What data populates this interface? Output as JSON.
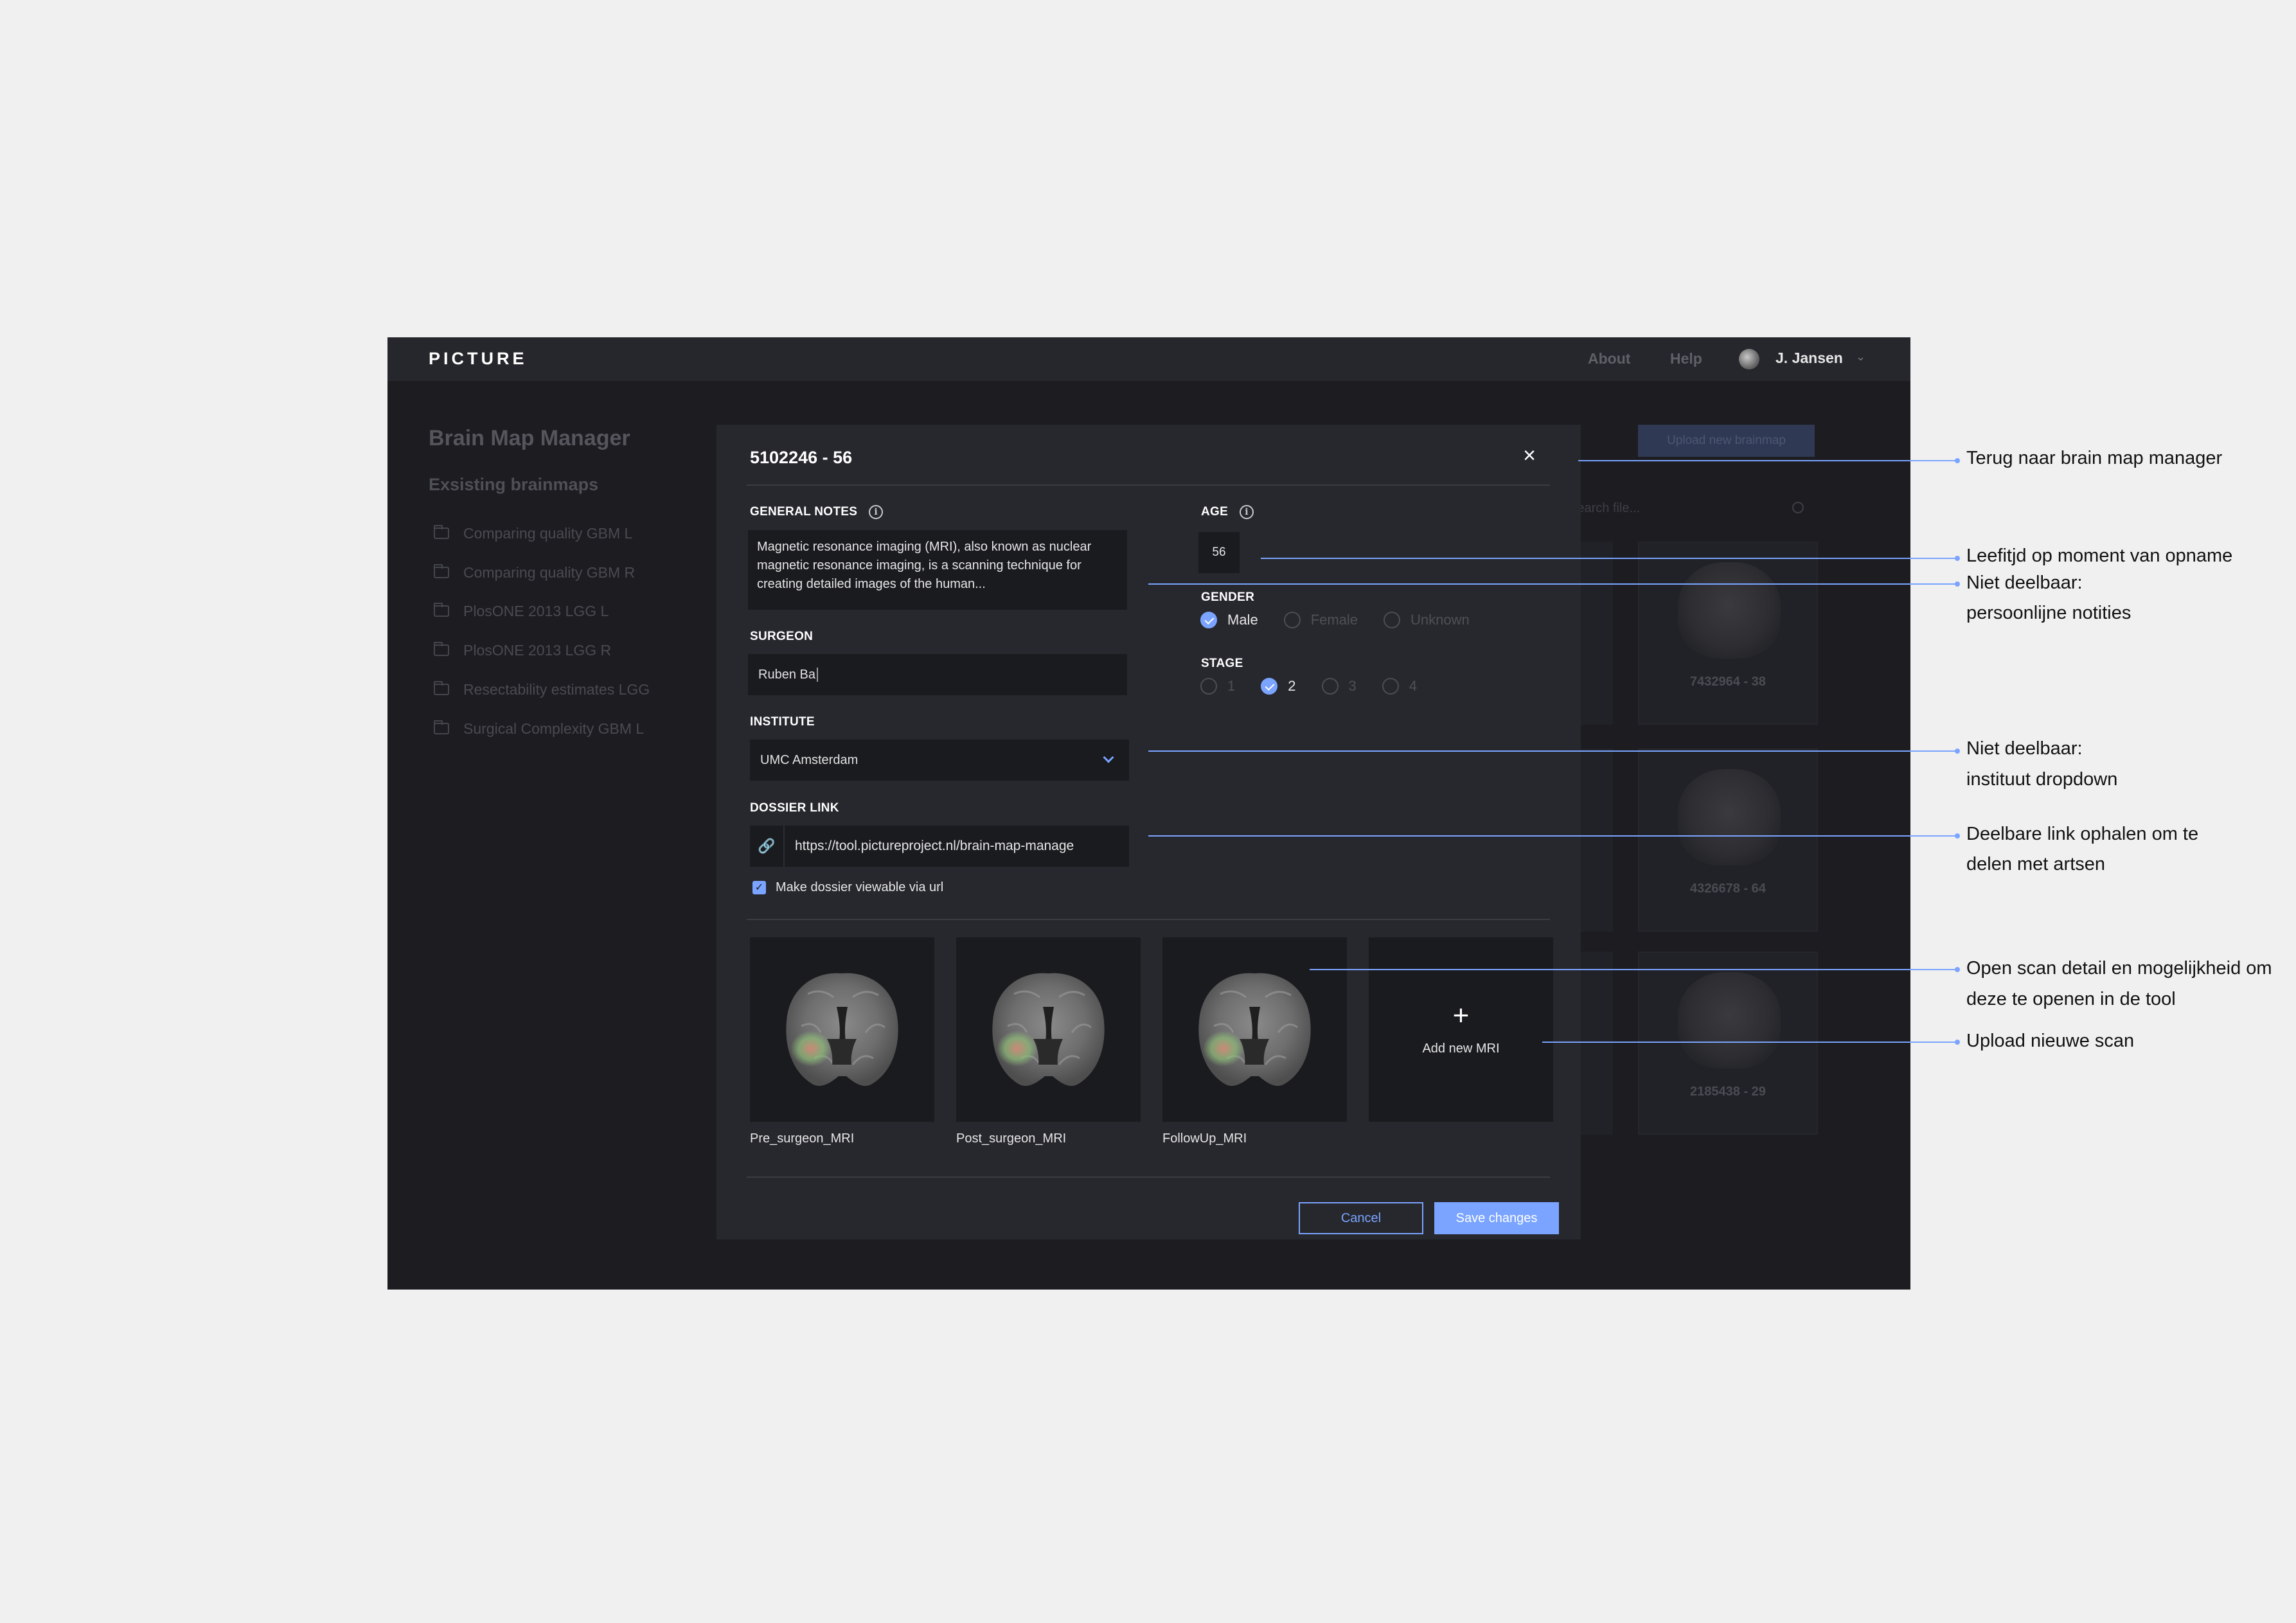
{
  "app": {
    "logo": "PICTURE",
    "nav": {
      "about": "About",
      "help": "Help"
    },
    "user": {
      "name": "J. Jansen"
    }
  },
  "background": {
    "title": "Brain Map Manager",
    "subtitle": "Exsisting brainmaps",
    "folders": [
      "Comparing quality GBM L",
      "Comparing quality GBM R",
      "PlosONE 2013 LGG L",
      "PlosONE 2013 LGG R",
      "Resectability estimates LGG",
      "Surgical Complexity GBM L"
    ],
    "upload_button": "Upload new brainmap",
    "search_placeholder": "Search file...",
    "cards": [
      {
        "name": "7432964 - 38"
      },
      {
        "name": "4326678 - 64"
      },
      {
        "name": "2185438 - 29"
      }
    ]
  },
  "modal": {
    "title": "5102246 - 56",
    "close_symbol": "×",
    "general_notes": {
      "label": "GENERAL NOTES",
      "value": "Magnetic resonance imaging (MRI), also known as nuclear magnetic resonance imaging, is a scanning technique for creating detailed images of the human..."
    },
    "surgeon": {
      "label": "SURGEON",
      "value": "Ruben Ba"
    },
    "institute": {
      "label": "INSTITUTE",
      "value": "UMC Amsterdam"
    },
    "dossier_link": {
      "label": "DOSSIER LINK",
      "value": "https://tool.pictureproject.nl/brain-map-manage"
    },
    "viewable_checkbox": {
      "label": "Make dossier viewable via url",
      "checked": true
    },
    "age": {
      "label": "AGE",
      "value": "56"
    },
    "gender": {
      "label": "GENDER",
      "options": [
        "Male",
        "Female",
        "Unknown"
      ],
      "selected": "Male"
    },
    "stage": {
      "label": "STAGE",
      "options": [
        "1",
        "2",
        "3",
        "4"
      ],
      "selected": "2"
    },
    "mri_scans": [
      {
        "caption": "Pre_surgeon_MRI"
      },
      {
        "caption": "Post_surgeon_MRI"
      },
      {
        "caption": "FollowUp_MRI"
      }
    ],
    "add_mri": {
      "symbol": "+",
      "label": "Add new MRI"
    },
    "cancel_button": "Cancel",
    "save_button": "Save changes"
  },
  "annotations": [
    {
      "lines": [
        "Terug naar brain map manager"
      ]
    },
    {
      "lines": [
        "Leefitjd op moment van opname"
      ]
    },
    {
      "lines": [
        "Niet deelbaar:",
        "persoonlijne notities"
      ]
    },
    {
      "lines": [
        "Niet deelbaar:",
        "instituut dropdown"
      ]
    },
    {
      "lines": [
        "Deelbare link ophalen om te",
        "delen met artsen"
      ]
    },
    {
      "lines": [
        "Open scan detail en mogelijkheid om",
        "deze te openen in de tool"
      ]
    },
    {
      "lines": [
        "Upload nieuwe scan"
      ]
    }
  ],
  "colors": {
    "accent": "#7aa4ff",
    "app_background": "#1c1c21",
    "modal_background": "#27282d",
    "input_background": "#1a1b1f",
    "canvas_background": "#f0f0f0"
  }
}
